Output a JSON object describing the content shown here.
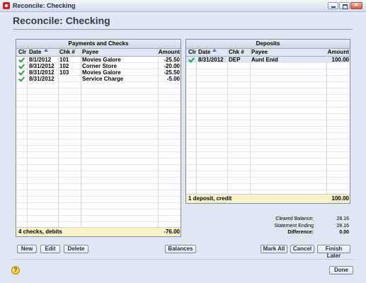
{
  "window": {
    "title": "Reconcile: Checking"
  },
  "header": {
    "title": "Reconcile: Checking"
  },
  "payments": {
    "title": "Payments and Checks",
    "columns": {
      "clr": "Clr",
      "date": "Date",
      "chk": "Chk #",
      "payee": "Payee",
      "amount": "Amount"
    },
    "rows": [
      {
        "cleared": true,
        "date": "8/1/2012",
        "chk": "101",
        "payee": "Movies Galore",
        "amount": "-25.50"
      },
      {
        "cleared": true,
        "date": "8/31/2012",
        "chk": "102",
        "payee": "Corner Store",
        "amount": "-20.00"
      },
      {
        "cleared": true,
        "date": "8/31/2012",
        "chk": "103",
        "payee": "Movies Galore",
        "amount": "-25.50"
      },
      {
        "cleared": true,
        "date": "8/31/2012",
        "chk": "",
        "payee": "Service Charge",
        "amount": "-5.00"
      }
    ],
    "footer": {
      "label": "4 checks, debits",
      "total": "-76.00"
    }
  },
  "deposits": {
    "title": "Deposits",
    "columns": {
      "clr": "Clr",
      "date": "Date",
      "chk": "Chk #",
      "payee": "Payee",
      "amount": "Amount"
    },
    "rows": [
      {
        "cleared": true,
        "date": "8/31/2012",
        "chk": "DEP",
        "payee": "Aunt Enid",
        "amount": "100.00"
      }
    ],
    "footer": {
      "label": "1 deposit, credit",
      "total": "100.00"
    }
  },
  "summary": {
    "cleared_balance_label": "Cleared Balance:",
    "cleared_balance": "28.16",
    "statement_ending_label": "Statement Ending",
    "statement_ending": "28.16",
    "difference_label": "Difference:",
    "difference": "0.00"
  },
  "buttons": {
    "new": "New",
    "edit": "Edit",
    "delete": "Delete",
    "balances": "Balances",
    "mark_all": "Mark All",
    "cancel": "Cancel",
    "finish_later": "Finish Later",
    "done": "Done"
  },
  "help": {
    "glyph": "?"
  },
  "colors": {
    "footer_bg": "#fbf3c8",
    "check": "#2d9b3c",
    "selected_row": "#dde7f5",
    "window_bg": "#dfe7f3"
  }
}
